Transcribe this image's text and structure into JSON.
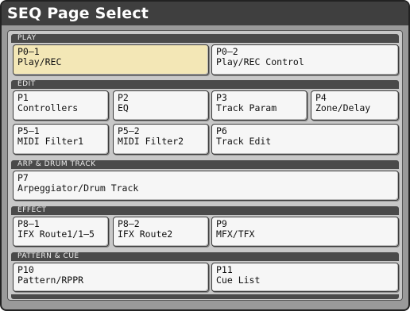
{
  "window": {
    "title": "SEQ Page Select"
  },
  "sections": {
    "play": {
      "header": "PLAY",
      "p0_1": {
        "num": "P0–1",
        "name": "Play/REC"
      },
      "p0_2": {
        "num": "P0–2",
        "name": "Play/REC Control"
      }
    },
    "edit": {
      "header": "EDIT",
      "p1": {
        "num": "P1",
        "name": "Controllers"
      },
      "p2": {
        "num": "P2",
        "name": "EQ"
      },
      "p3": {
        "num": "P3",
        "name": "Track Param"
      },
      "p4": {
        "num": "P4",
        "name": "Zone/Delay"
      },
      "p5_1": {
        "num": "P5–1",
        "name": "MIDI Filter1"
      },
      "p5_2": {
        "num": "P5–2",
        "name": "MIDI Filter2"
      },
      "p6": {
        "num": "P6",
        "name": "Track Edit"
      }
    },
    "arp": {
      "header": "ARP & DRUM TRACK",
      "p7": {
        "num": "P7",
        "name": "Arpeggiator/Drum Track"
      }
    },
    "effect": {
      "header": "EFFECT",
      "p8_1": {
        "num": "P8–1",
        "name": "IFX Route1/1–5"
      },
      "p8_2": {
        "num": "P8–2",
        "name": "IFX Route2"
      },
      "p9": {
        "num": "P9",
        "name": "MFX/TFX"
      }
    },
    "pattern": {
      "header": "PATTERN & CUE",
      "p10": {
        "num": "P10",
        "name": "Pattern/RPPR"
      },
      "p11": {
        "num": "P11",
        "name": "Cue List"
      }
    }
  },
  "selected_page": "P0–1"
}
